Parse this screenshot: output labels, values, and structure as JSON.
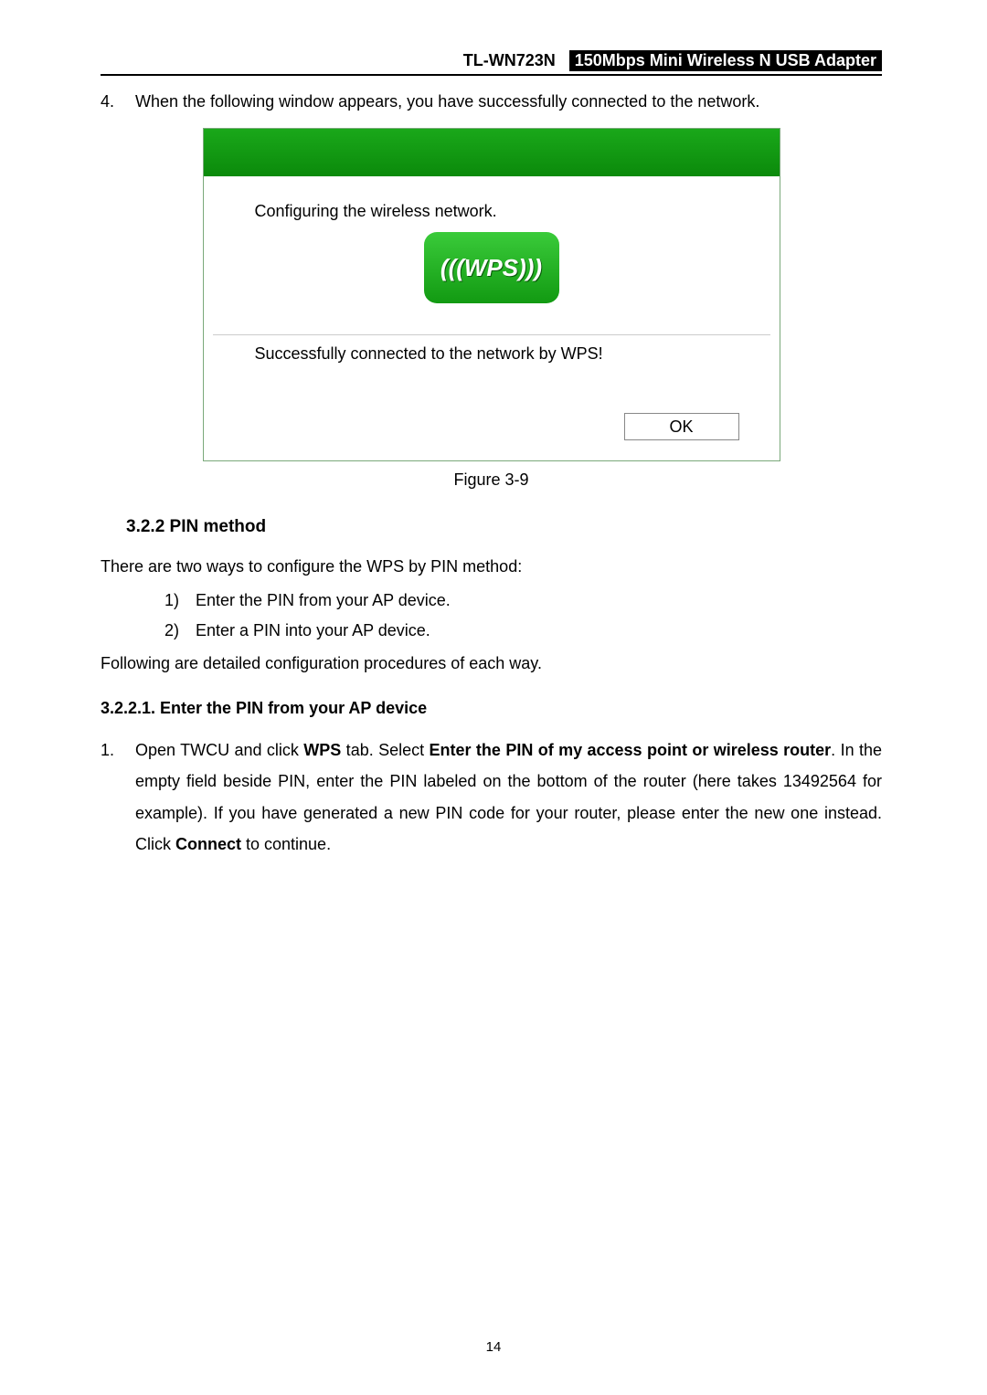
{
  "header": {
    "model": "TL-WN723N",
    "desc": "150Mbps Mini Wireless N USB Adapter"
  },
  "step4": {
    "num": "4.",
    "text": "When the following window appears, you have successfully connected to the network."
  },
  "dialog": {
    "configuring": "Configuring the wireless network.",
    "wps_label": "(((WPS)))",
    "success": "Successfully connected to the network by WPS!",
    "ok": "OK"
  },
  "figure_caption": "Figure 3-9",
  "section_322": "3.2.2  PIN method",
  "intro_line": "There are two ways to configure the WPS by PIN method:",
  "list1": {
    "n1": "1)",
    "t1": "Enter the PIN from your AP device.",
    "n2": "2)",
    "t2": "Enter a PIN into your AP device."
  },
  "following_line": "Following are detailed configuration procedures of each way.",
  "sub_3221": "3.2.2.1.  Enter the PIN from your AP device",
  "step1": {
    "num": "1.",
    "t_a": "Open TWCU and click ",
    "t_b": "WPS",
    "t_c": " tab. Select ",
    "t_d": "Enter the PIN of my access point or wireless router",
    "t_e": ". In the empty field beside PIN, enter the PIN labeled on the bottom of the router (here takes 13492564 for example). If you have generated a new PIN code for your router, please enter the new one instead. Click ",
    "t_f": "Connect",
    "t_g": " to continue."
  },
  "page_number": "14"
}
